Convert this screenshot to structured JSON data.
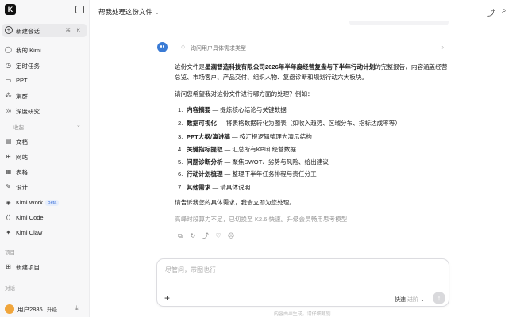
{
  "sidebar": {
    "logo": "K",
    "new_chat": {
      "label": "新建会话",
      "shortcut": "⌘ K"
    },
    "items": [
      {
        "label": "我的 Kimi",
        "icon": "circle-icon"
      },
      {
        "label": "定时任务",
        "icon": "clock-icon"
      },
      {
        "label": "PPT",
        "icon": "slides-icon"
      },
      {
        "label": "集群",
        "icon": "cluster-icon"
      },
      {
        "label": "深度研究",
        "icon": "research-icon"
      }
    ],
    "group_label": "收起",
    "tools": [
      {
        "label": "文档",
        "icon": "document-icon"
      },
      {
        "label": "网站",
        "icon": "globe-icon"
      },
      {
        "label": "表格",
        "icon": "table-icon"
      },
      {
        "label": "设计",
        "icon": "design-icon"
      }
    ],
    "apps": [
      {
        "label": "Kimi Work",
        "badge": "Beta",
        "icon": "work-icon"
      },
      {
        "label": "Kimi Code",
        "icon": "code-icon"
      },
      {
        "label": "Kimi Claw",
        "icon": "claw-icon"
      }
    ],
    "projects_label": "项目",
    "new_project": "新建项目",
    "history_label": "对话",
    "user": {
      "name": "用户2885",
      "upgrade": "升级"
    }
  },
  "topbar": {
    "title": "帮我处理这份文件"
  },
  "chat": {
    "thinking_label": "询问用户具体需求类型",
    "intro_pre": "这份文件是",
    "intro_bold": "星澜智造科技有限公司2026年半年度经营复盘与下半年行动计划",
    "intro_post": "的完整报告，内容涵盖经营总览、市场客户、产品交付、组织人物、复盘诊断和规划行动六大板块。",
    "ask": "请问您希望我对这份文件进行哪方面的处理？例如：",
    "options": [
      {
        "num": "1.",
        "title": "内容摘要",
        "desc": " — 提炼核心结论与关键数据"
      },
      {
        "num": "2.",
        "title": "数据可视化",
        "desc": " — 将表格数据转化为图表（如收入趋势、区域分布、指标达成率等）"
      },
      {
        "num": "3.",
        "title": "PPT大纲/演讲稿",
        "desc": " — 按汇报逻辑整理为演示结构"
      },
      {
        "num": "4.",
        "title": "关键指标提取",
        "desc": " — 汇总所有KPI和经营数据"
      },
      {
        "num": "5.",
        "title": "问题诊断分析",
        "desc": " — 聚焦SWOT、劣势与风险、给出建议"
      },
      {
        "num": "6.",
        "title": "行动计划梳理",
        "desc": " — 整理下半年任务排程与责任分工"
      },
      {
        "num": "7.",
        "title": "其他需求",
        "desc": " — 请具体说明"
      }
    ],
    "closing": "请告诉我您的具体需求，我会立即为您处理。",
    "notice": "高峰时段算力不足，已切换至 K2.6 快速。升级会员畅用思考模型"
  },
  "input": {
    "placeholder": "尽管问，带图也行",
    "mode": "快速",
    "mode_sub": "进阶"
  },
  "disclaimer": "内容由AI生成，请仔细甄别"
}
